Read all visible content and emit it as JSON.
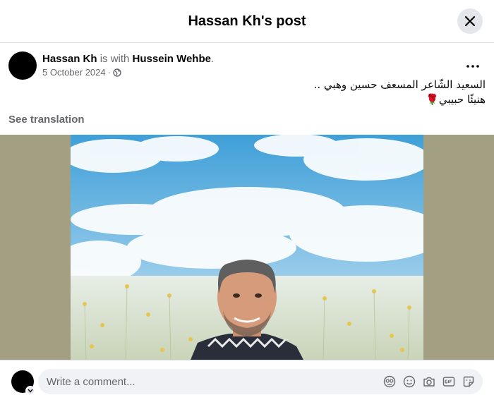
{
  "header": {
    "title": "Hassan Kh's post"
  },
  "post": {
    "author": "Hassan Kh",
    "with_text": " is with ",
    "tagged": "Hussein Wehbe",
    "tagged_suffix": ".",
    "date": "5 October 2024",
    "separator": "·",
    "text_line1": "السعيد الشّاعر المسعف حسين وهبي ..",
    "text_line2": "هنيئًا حبيبي🌹",
    "see_translation": "See translation"
  },
  "comment": {
    "placeholder": "Write a comment..."
  },
  "icons": {
    "close": "close-icon",
    "more": "more-icon",
    "globe": "globe-icon",
    "avatar_sticker": "avatar-sticker-icon",
    "emoji": "emoji-icon",
    "camera": "camera-icon",
    "gif": "gif-icon",
    "sticker": "sticker-icon"
  },
  "colors": {
    "photo_background": "#a39f83",
    "secondary_text": "#65676b",
    "input_background": "#f0f2f5"
  }
}
